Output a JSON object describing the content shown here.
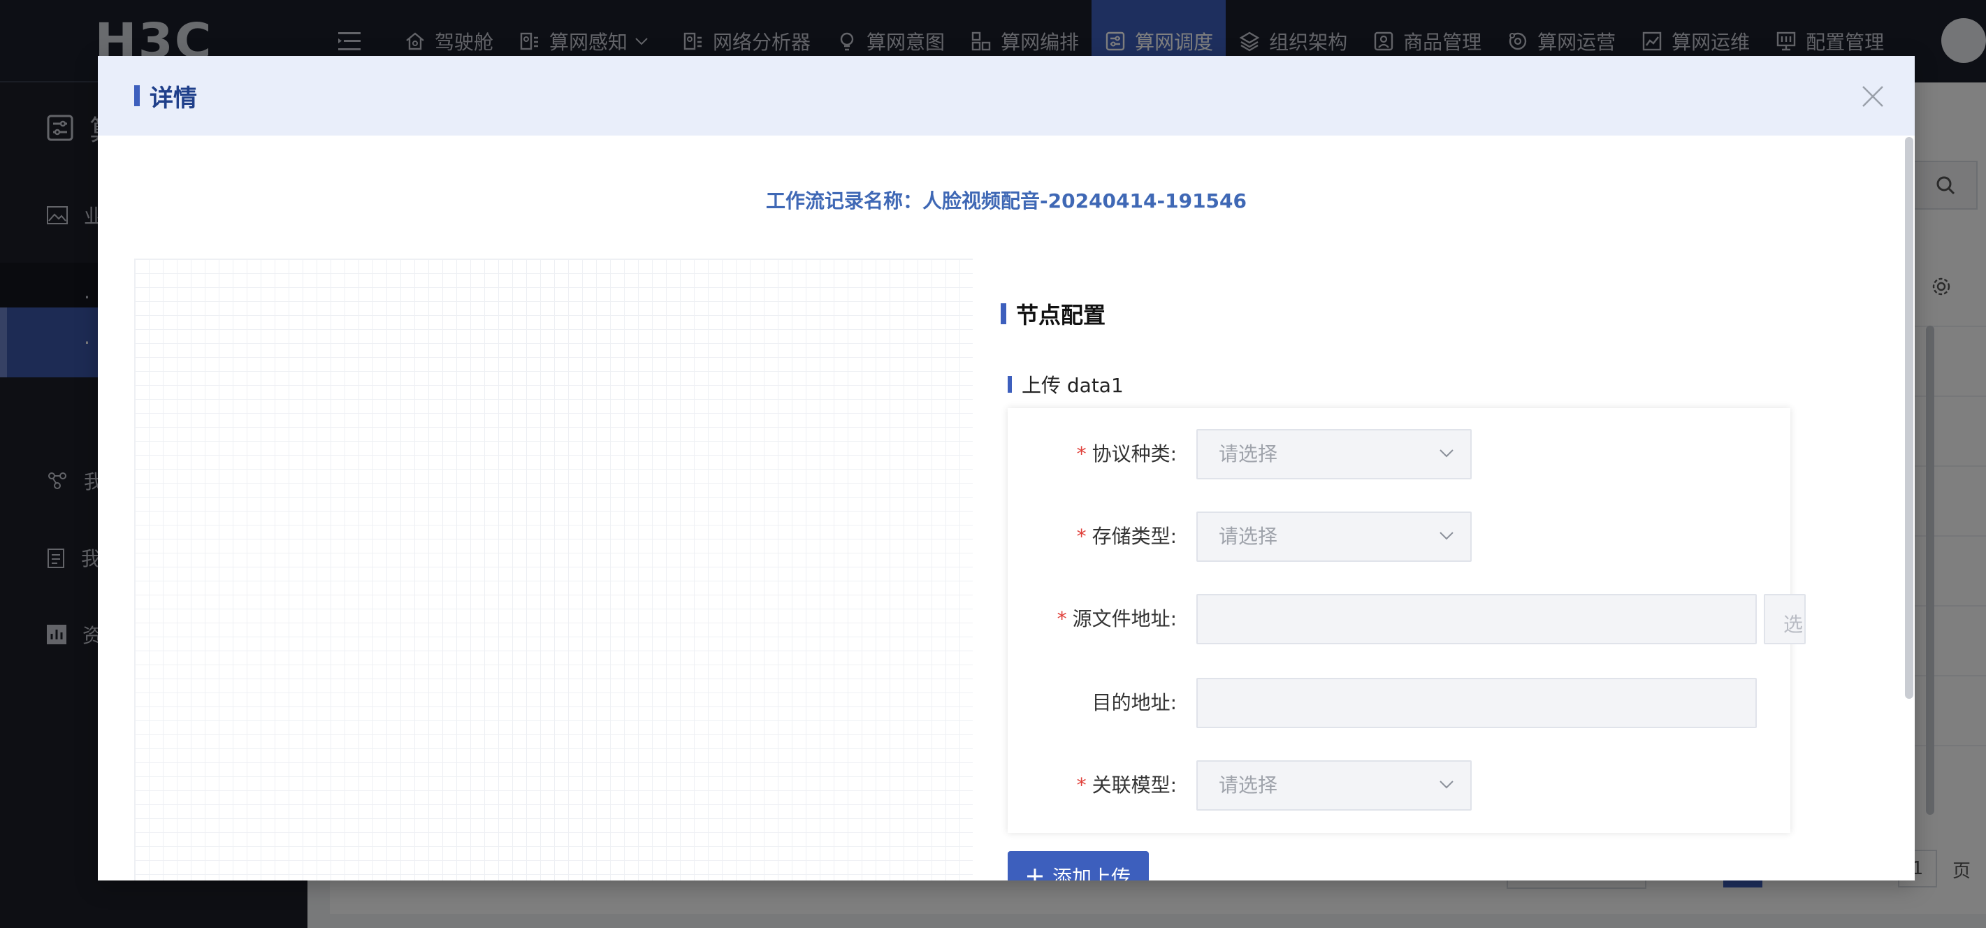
{
  "app": {
    "logo": "H3C",
    "nav": [
      {
        "label": "驾驶舱",
        "icon": "home-icon"
      },
      {
        "label": "算网感知",
        "icon": "id-card-icon",
        "has_caret": true
      },
      {
        "label": "网络分析器",
        "icon": "id-card-icon"
      },
      {
        "label": "算网意图",
        "icon": "bulb-icon"
      },
      {
        "label": "算网编排",
        "icon": "layout-icon"
      },
      {
        "label": "算网调度",
        "icon": "sliders-icon",
        "active": true
      },
      {
        "label": "组织架构",
        "icon": "layers-icon"
      },
      {
        "label": "商品管理",
        "icon": "person-card-icon"
      },
      {
        "label": "算网运营",
        "icon": "ops-icon"
      },
      {
        "label": "算网运维",
        "icon": "line-chart-icon"
      },
      {
        "label": "配置管理",
        "icon": "monitor-icon"
      }
    ],
    "sidebar": {
      "header_label": "算",
      "items": [
        {
          "label": "业"
        },
        {
          "label": "·"
        },
        {
          "label": "·"
        },
        {
          "label": "我"
        },
        {
          "label": "我"
        },
        {
          "label": "资"
        }
      ]
    },
    "pager": {
      "page_value": "1",
      "page_suffix": "页"
    }
  },
  "modal": {
    "title": "详情",
    "record_label": "工作流记录名称：",
    "record_name": "人脸视频配音-20240414-191546",
    "config_title": "节点配置",
    "node_title": "上传 data1",
    "form": {
      "protocol": {
        "label": "协议种类:",
        "placeholder": "请选择",
        "required": true
      },
      "storage": {
        "label": "存储类型:",
        "placeholder": "请选择",
        "required": true
      },
      "source": {
        "label": "源文件地址:",
        "value": "",
        "required": true,
        "side_button_label": "选"
      },
      "target": {
        "label": "目的地址:",
        "value": "",
        "required": false
      },
      "model": {
        "label": "关联模型:",
        "placeholder": "请选择",
        "required": true
      }
    },
    "add_button_label": "添加上传",
    "required_mark": "*"
  },
  "colors": {
    "accent": "#3d5fbd",
    "topbar": "#1b1f2b",
    "sidebar": "#1c1f29",
    "modal_header": "#e9eefa",
    "required": "#e0403a",
    "record_text": "#3f68b5"
  }
}
